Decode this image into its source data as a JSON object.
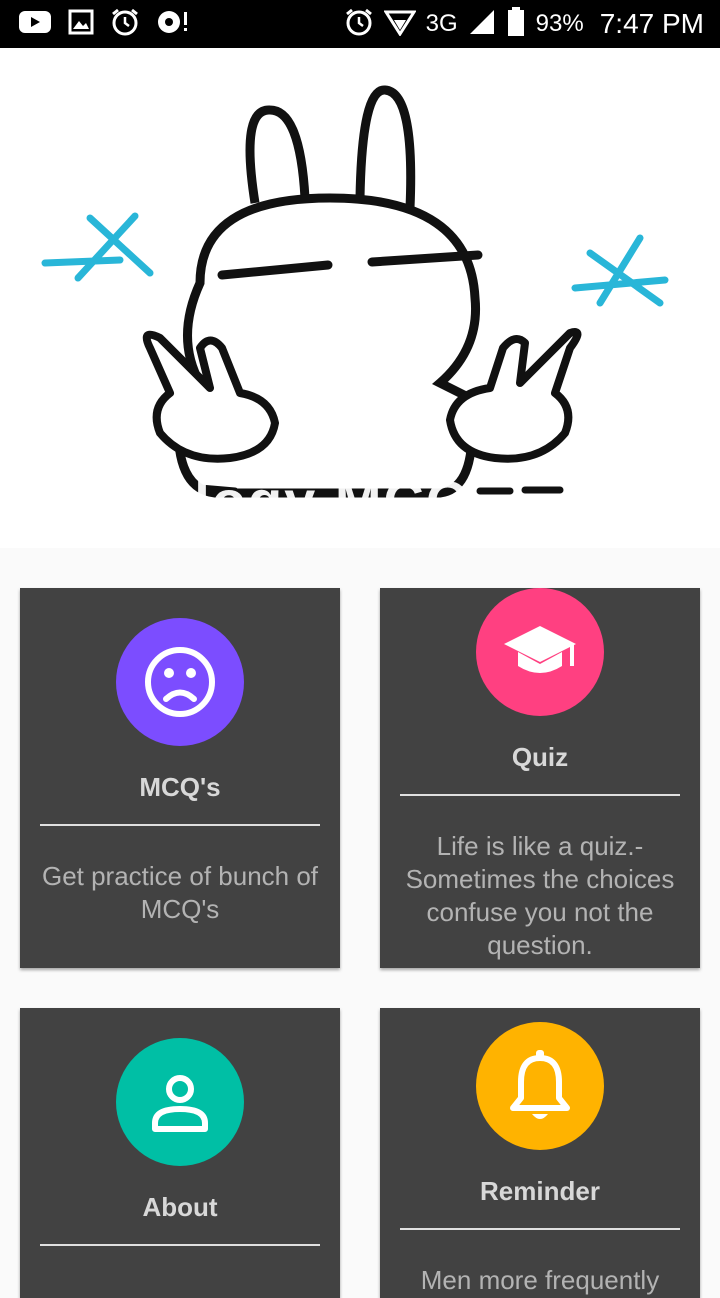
{
  "status_bar": {
    "icons_left": [
      "youtube-icon",
      "image-icon",
      "alarm-icon",
      "app-notification-icon"
    ],
    "icons_right": [
      "alarm-icon",
      "wifi-icon",
      "signal-icon",
      "battery-icon"
    ],
    "network": "3G",
    "battery": "93%",
    "time": "7:47 PM"
  },
  "header": {
    "title": "Biology MCQ",
    "illustration": "bunny-peace-sign-illustration"
  },
  "cards": [
    {
      "title": "MCQ's",
      "description": "Get practice of bunch of MCQ's",
      "icon": "sad-face-icon",
      "color": "#7c4dff"
    },
    {
      "title": "Quiz",
      "description": "Life is like a quiz.- Sometimes the choices confuse you not the question.",
      "icon": "graduation-cap-icon",
      "color": "#ff4081"
    },
    {
      "title": "About",
      "description": "",
      "icon": "person-icon",
      "color": "#00bfa5"
    },
    {
      "title": "Reminder",
      "description": "Men more frequently",
      "icon": "bell-icon",
      "color": "#ffb300"
    }
  ]
}
